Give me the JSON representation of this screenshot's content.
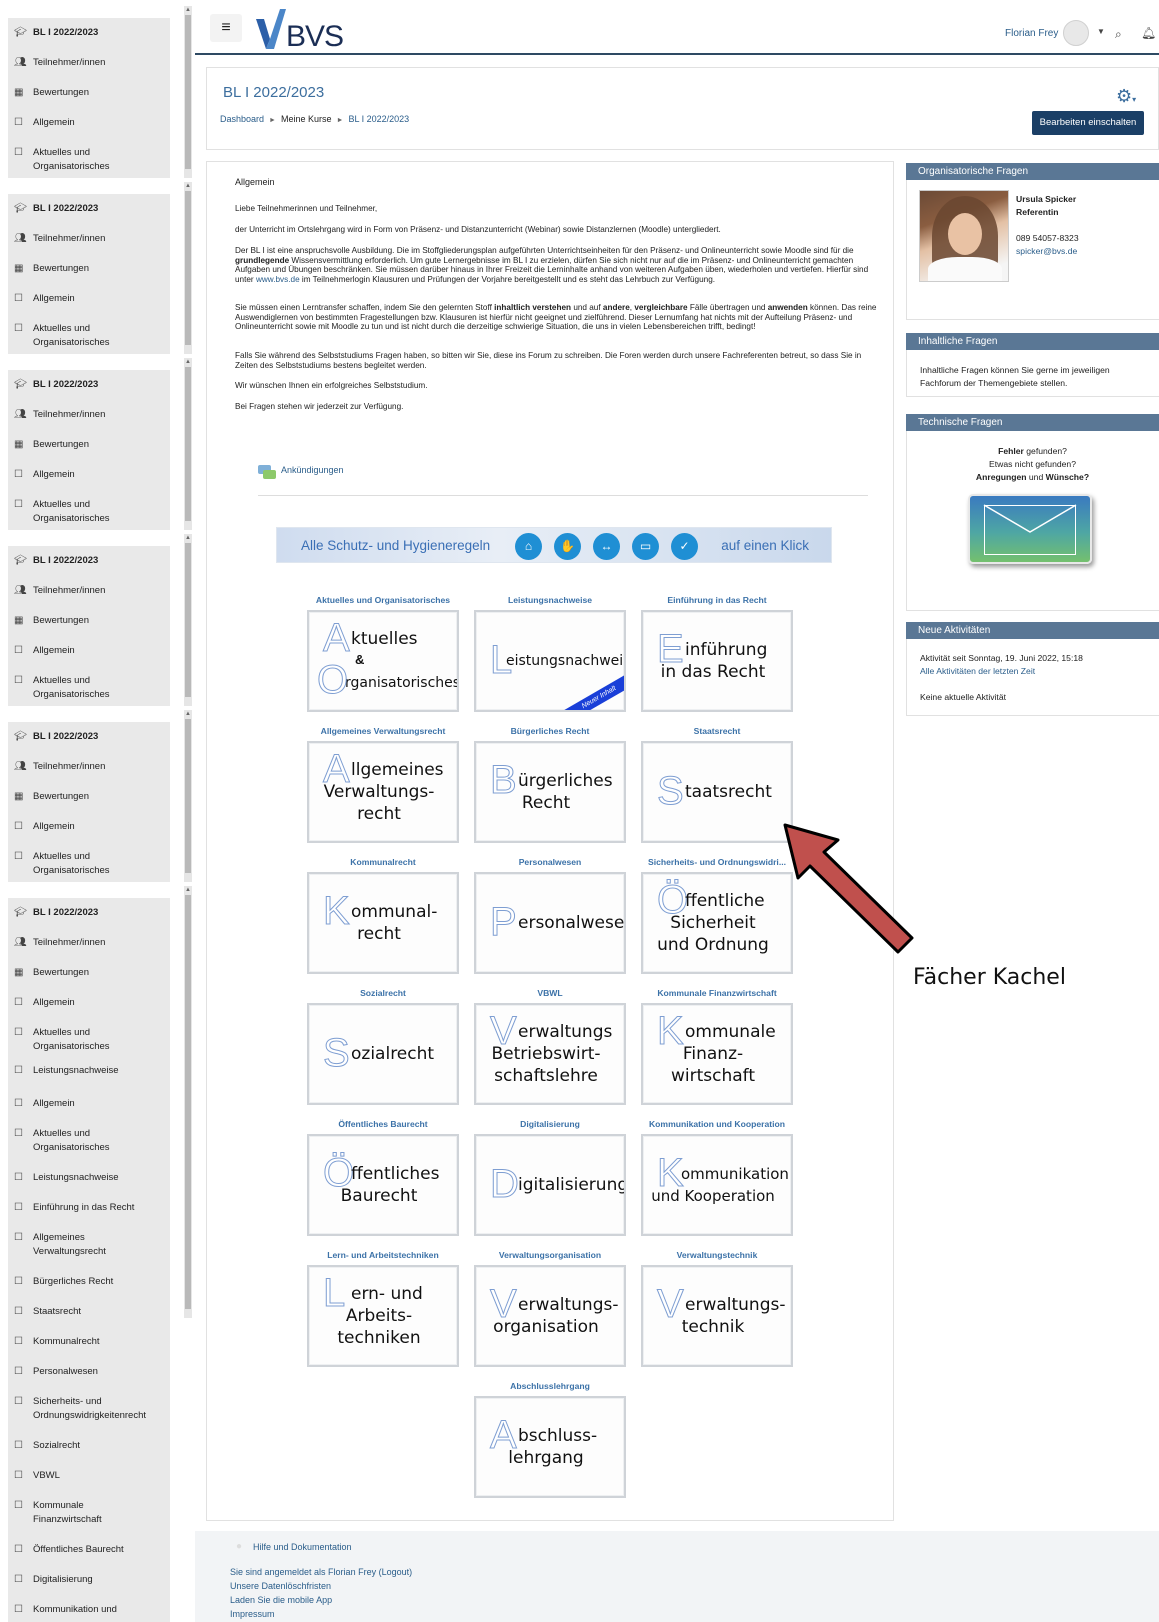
{
  "header": {
    "logo_text": "BVS",
    "user_name": "Florian Frey",
    "menu_icon": "hamburger-icon"
  },
  "course": {
    "title": "BL I 2022/2023",
    "breadcrumb": [
      "Dashboard",
      "Meine Kurse",
      "BL I 2022/2023"
    ],
    "edit_button": "Bearbeiten einschalten"
  },
  "sidebar": {
    "block_items": [
      "BL I 2022/2023",
      "Teilnehmer/innen",
      "Bewertungen",
      "Allgemein",
      "Aktuelles und",
      "Organisatorisches"
    ],
    "extra_items": [
      [
        "Leistungsnachweise"
      ],
      [
        "Allgemein"
      ],
      [
        "Aktuelles und",
        "Organisatorisches"
      ],
      [
        "Leistungsnachweise"
      ],
      [
        "Einführung in das Recht"
      ],
      [
        "Allgemeines",
        "Verwaltungsrecht"
      ],
      [
        "Bürgerliches Recht"
      ],
      [
        "Staatsrecht"
      ],
      [
        "Kommunalrecht"
      ],
      [
        "Personalwesen"
      ],
      [
        "Sicherheits- und",
        "Ordnungswidrigkeitenrecht"
      ],
      [
        "Sozialrecht"
      ],
      [
        "VBWL"
      ],
      [
        "Kommunale",
        "Finanzwirtschaft"
      ],
      [
        "Öffentliches Baurecht"
      ],
      [
        "Digitalisierung"
      ],
      [
        "Kommunikation und"
      ]
    ]
  },
  "main": {
    "section_title": "Allgemein",
    "greeting": "Liebe Teilnehmerinnen und Teilnehmer,",
    "p1": "der Unterricht im Ortslehrgang wird in Form von Präsenz- und Distanzunterricht (Webinar) sowie Distanzlernen (Moodle) untergliedert.",
    "p2a": "Der BL I ist eine anspruchsvolle Ausbildung. Die im Stoffgliederungsplan aufgeführten Unterrichtseinheiten für den Präsenz- und Onlineunterricht sowie Moodle sind für die ",
    "p2b": "grundlegende",
    "p2c": " Wissensvermittlung erforderlich. Um gute Lernergebnisse im BL I zu erzielen, dürfen Sie sich nicht nur auf die im Präsenz- und Onlineunterricht gemachten Aufgaben und Übungen beschränken. Sie müssen darüber hinaus in Ihrer Freizeit die Lerninhalte anhand von weiteren Aufgaben üben, wiederholen und vertiefen. Hierfür sind unter ",
    "p2link": "www.bvs.de",
    "p2d": " im Teilnehmerlogin Klausuren und Prüfungen der Vorjahre bereitgestellt und es steht das Lehrbuch zur Verfügung.",
    "p3a": "Sie müssen einen Lerntransfer schaffen, indem Sie den gelernten Stoff ",
    "p3b": "inhaltlich verstehen",
    "p3c": " und auf ",
    "p3d": "andere",
    "p3e": ", ",
    "p3f": "vergleichbare",
    "p3g": " Fälle übertragen und ",
    "p3h": "anwenden",
    "p3i": " können. Das reine Auswendiglernen von bestimmten Fragestellungen bzw. Klausuren ist hierfür nicht geeignet und zielführend. Dieser Lernumfang hat nichts mit der Aufteilung Präsenz- und Onlineunterricht sowie mit Moodle zu tun und ist nicht durch die derzeitige schwierige Situation, die uns in vielen Lebensbereichen trifft, bedingt!",
    "p4": "Falls Sie während des Selbststudiums Fragen haben, so bitten wir Sie, diese ins Forum zu schreiben. Die Foren werden durch unsere Fachreferenten betreut, so dass Sie in Zeiten des Selbststudiums bestens begleitet werden.",
    "p5": "Wir wünschen Ihnen ein erfolgreiches Selbststudium.",
    "p6": "Bei Fragen stehen wir jederzeit zur Verfügung.",
    "announcements": "Ankündigungen",
    "banner_left": "Alle Schutz- und Hygieneregeln",
    "banner_right": "auf einen Klick"
  },
  "tiles": [
    {
      "label": "Aktuelles und Organisatorisches",
      "initial": "A",
      "text": [
        "ktuelles",
        "&",
        "rganisatorisches"
      ],
      "initial2": "O"
    },
    {
      "label": "Leistungsnachweise",
      "initial": "L",
      "text": [
        "eistungsnachweise"
      ],
      "badge": "Neuer Inhalt"
    },
    {
      "label": "Einführung in das Recht",
      "initial": "E",
      "text": [
        "inführung",
        "in das Recht"
      ]
    },
    {
      "label": "Allgemeines Verwaltungsrecht",
      "initial": "A",
      "text": [
        "llgemeines",
        "Verwaltungs-",
        "recht"
      ]
    },
    {
      "label": "Bürgerliches Recht",
      "initial": "B",
      "text": [
        "ürgerliches",
        "Recht"
      ]
    },
    {
      "label": "Staatsrecht",
      "initial": "S",
      "text": [
        "taatsrecht"
      ]
    },
    {
      "label": "Kommunalrecht",
      "initial": "K",
      "text": [
        "ommunal-",
        "recht"
      ]
    },
    {
      "label": "Personalwesen",
      "initial": "P",
      "text": [
        "ersonalwesen"
      ]
    },
    {
      "label": "Sicherheits- und Ordnungswidri...",
      "initial": "Ö",
      "text": [
        "ffentliche",
        "Sicherheit",
        "und Ordnung"
      ]
    },
    {
      "label": "Sozialrecht",
      "initial": "S",
      "text": [
        "ozialrecht"
      ]
    },
    {
      "label": "VBWL",
      "initial": "V",
      "text": [
        "erwaltungs",
        "Betriebswirt-",
        "schaftslehre"
      ]
    },
    {
      "label": "Kommunale Finanzwirtschaft",
      "initial": "K",
      "text": [
        "ommunale",
        "Finanz-",
        "wirtschaft"
      ]
    },
    {
      "label": "Öffentliches Baurecht",
      "initial": "Ö",
      "text": [
        "ffentliches",
        "Baurecht"
      ]
    },
    {
      "label": "Digitalisierung",
      "initial": "D",
      "text": [
        "igitalisierung"
      ]
    },
    {
      "label": "Kommunikation und Kooperation",
      "initial": "K",
      "text": [
        "ommunikation",
        "und Kooperation"
      ]
    },
    {
      "label": "Lern- und Arbeitstechniken",
      "initial": "L",
      "text": [
        "ern- und",
        "Arbeits-",
        "techniken"
      ]
    },
    {
      "label": "Verwaltungsorganisation",
      "initial": "V",
      "text": [
        "erwaltungs-",
        "organisation"
      ]
    },
    {
      "label": "Verwaltungstechnik",
      "initial": "V",
      "text": [
        "erwaltungs-",
        "technik"
      ]
    },
    {
      "label": "Abschlusslehrgang",
      "initial": "A",
      "text": [
        "bschluss-",
        "lehrgang"
      ]
    }
  ],
  "annotation": {
    "text": "Fächer Kachel"
  },
  "blocks": {
    "org_title": "Organisatorische Fragen",
    "contact_name": "Ursula Spicker",
    "contact_role": "Referentin",
    "contact_phone": "089 54057-8323",
    "contact_mail": "spicker@bvs.de",
    "content_title": "Inhaltliche Fragen",
    "content_text1": "Inhaltliche Fragen können Sie gerne im jeweiligen",
    "content_text2": "Fachforum der Themengebiete stellen.",
    "tech_title": "Technische Fragen",
    "tech_l1a": "Fehler",
    "tech_l1b": " gefunden?",
    "tech_l2": "Etwas nicht gefunden?",
    "tech_l3a": "Anregungen",
    "tech_l3b": " und ",
    "tech_l3c": "Wünsche?",
    "act_title": "Neue Aktivitäten",
    "act_since": "Aktivität seit Sonntag, 19. Juni 2022, 15:18",
    "act_link": "Alle Aktivitäten der letzten Zeit",
    "act_none": "Keine aktuelle Aktivität"
  },
  "footer": {
    "help": "Hilfe und Dokumentation",
    "logged_in": "Sie sind angemeldet als Florian Frey (Logout)",
    "data_delete": "Unsere Datenlöschfristen",
    "mobile_app": "Laden Sie die mobile App",
    "imprint": "Impressum"
  }
}
